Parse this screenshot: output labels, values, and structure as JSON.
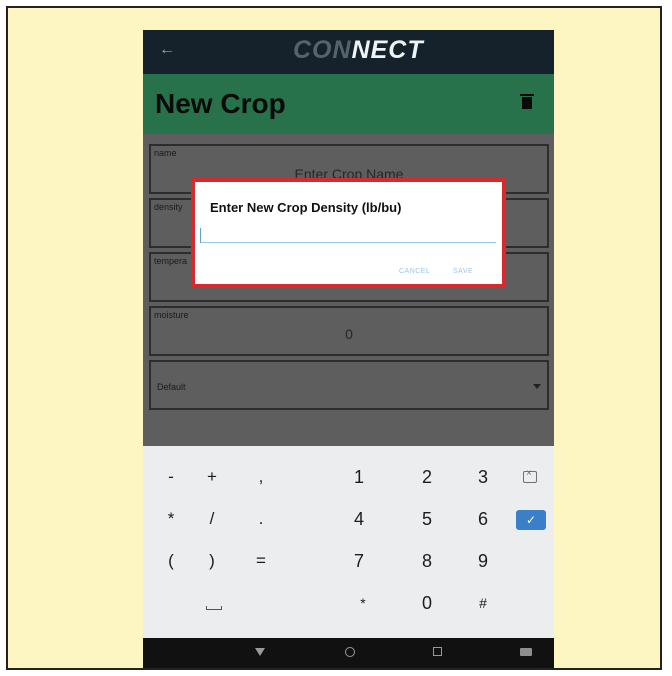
{
  "app": {
    "logo_part1": "CON",
    "logo_part2": "NECT",
    "page_title": "New Crop"
  },
  "form": {
    "fields": [
      {
        "label": "name",
        "value": "Enter Crop Name"
      },
      {
        "label": "density",
        "value": ""
      },
      {
        "label": "tempera",
        "value": ""
      },
      {
        "label": "moisture",
        "value": "0"
      },
      {
        "label": "Default",
        "value": ""
      }
    ]
  },
  "dialog": {
    "title": "Enter New Crop Density (lb/bu)",
    "input_value": "",
    "cancel_label": "CANCEL",
    "save_label": "SAVE"
  },
  "keyboard": {
    "rows": [
      [
        "-",
        "+",
        ",",
        "1",
        "2",
        "3"
      ],
      [
        "*",
        "/",
        ".",
        "4",
        "5",
        "6"
      ],
      [
        "(",
        ")",
        "=",
        "7",
        "8",
        "9"
      ],
      [
        "",
        "",
        "",
        "*",
        "0",
        "#"
      ]
    ]
  },
  "colors": {
    "topbar": "#15222c",
    "header_green": "#27724a",
    "highlight_red": "#d82a2e",
    "enter_blue": "#3a7fc8",
    "frame_bg": "#fdf5c2"
  }
}
